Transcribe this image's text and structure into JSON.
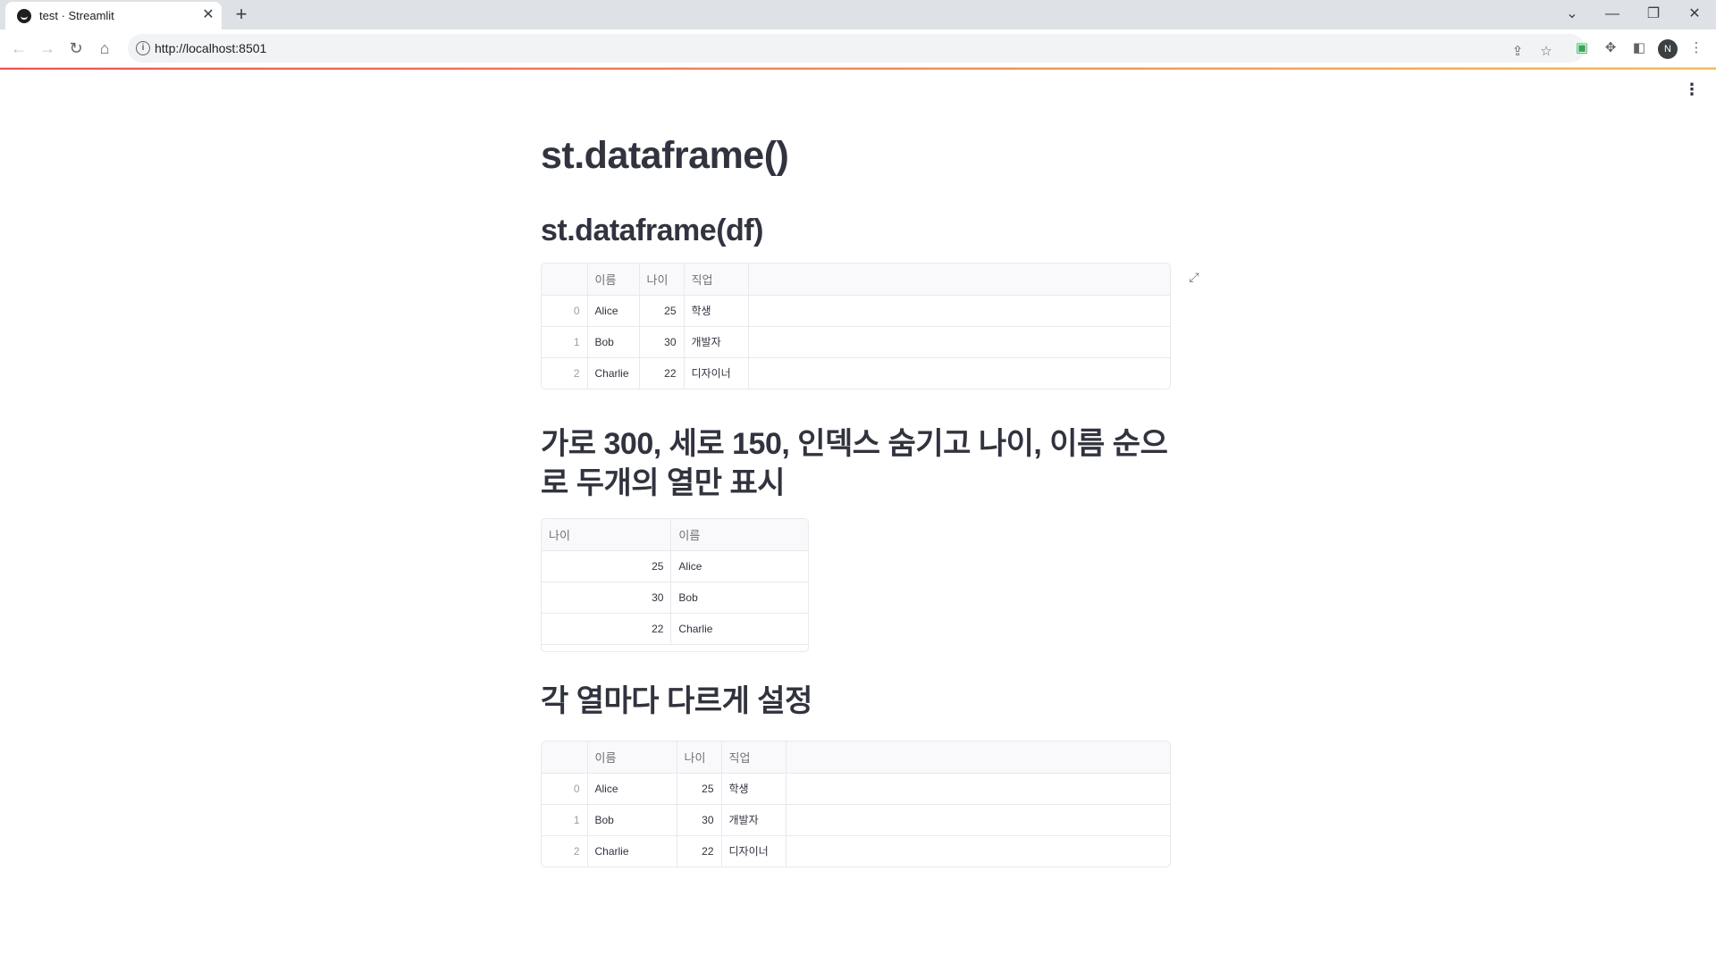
{
  "browser": {
    "tab_title": "test · Streamlit",
    "tab_close": "✕",
    "new_tab": "+",
    "url": "http://localhost:8501",
    "profile_initial": "N"
  },
  "page": {
    "title": "st.dataframe()",
    "menu_icon": "⋮",
    "sections": [
      {
        "heading": "st.dataframe(df)"
      },
      {
        "heading": "가로 300, 세로 150, 인덱스 숨기고 나이, 이름 순으로 두개의 열만 표시"
      },
      {
        "heading": "각 열마다 다르게 설정"
      }
    ]
  },
  "table1": {
    "headers": [
      "",
      "이름",
      "나이",
      "직업"
    ],
    "rows": [
      {
        "index": "0",
        "name": "Alice",
        "age": "25",
        "job": "학생"
      },
      {
        "index": "1",
        "name": "Bob",
        "age": "30",
        "job": "개발자"
      },
      {
        "index": "2",
        "name": "Charlie",
        "age": "22",
        "job": "디자이너"
      }
    ]
  },
  "table2": {
    "headers": [
      "나이",
      "이름"
    ],
    "rows": [
      {
        "age": "25",
        "name": "Alice"
      },
      {
        "age": "30",
        "name": "Bob"
      },
      {
        "age": "22",
        "name": "Charlie"
      }
    ]
  },
  "table3": {
    "headers": [
      "",
      "이름",
      "나이",
      "직업"
    ],
    "rows": [
      {
        "index": "0",
        "name": "Alice",
        "age": "25",
        "job": "학생"
      },
      {
        "index": "1",
        "name": "Bob",
        "age": "30",
        "job": "개발자"
      },
      {
        "index": "2",
        "name": "Charlie",
        "age": "22",
        "job": "디자이너"
      }
    ]
  }
}
